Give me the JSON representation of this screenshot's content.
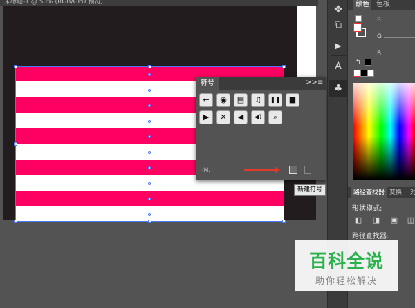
{
  "document": {
    "tab_title": "未标题-1 @ 50% (RGB/GPU 预览)"
  },
  "flag": {
    "stripe_color": "#ff0062",
    "background_color": "#ffffff"
  },
  "tools": {
    "items": [
      "puppet-warp-icon",
      "free-transform-icon",
      "play-icon",
      "text-area-icon",
      "club-symbol-icon"
    ]
  },
  "color_panel": {
    "tabs": [
      "颜色",
      "色板"
    ],
    "r_label": "R",
    "g_label": "G",
    "b_label": "B"
  },
  "symbols_panel": {
    "title": "符号",
    "collapse": ">>",
    "menu": "≡",
    "symbols": [
      "←",
      "◉",
      "▤",
      "♫",
      "❚❚",
      "■",
      "▶",
      "✕",
      "◀",
      "◀)",
      "⌕"
    ],
    "library_icon": "IN."
  },
  "tooltip": {
    "text": "新建符号"
  },
  "pathfinder": {
    "tabs": [
      "路径查找器",
      "变换",
      "对"
    ],
    "shape_modes_label": "形状模式:",
    "pathfinders_label": "路径查找器:"
  },
  "watermark": {
    "title": "百科全说",
    "subtitle": "助你轻松解决"
  }
}
